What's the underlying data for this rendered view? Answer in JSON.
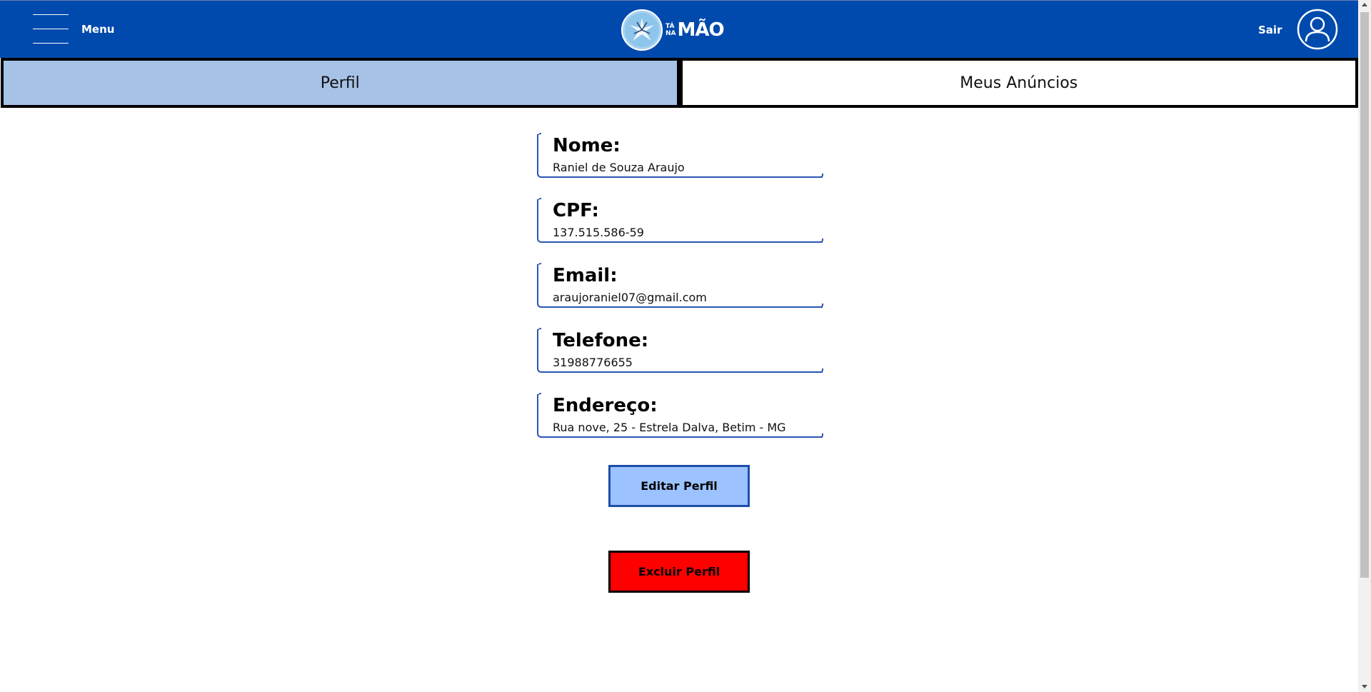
{
  "header": {
    "menu_label": "Menu",
    "logo": {
      "small_top": "TÁ",
      "small_bottom": "NA",
      "big": "MÃO"
    },
    "logout_label": "Sair",
    "background": "#004aad"
  },
  "tabs": [
    {
      "label": "Perfil",
      "active": true
    },
    {
      "label": "Meus Anúncios",
      "active": false
    }
  ],
  "profile": {
    "fields": [
      {
        "label": "Nome:",
        "value": "Raniel de Souza Araujo"
      },
      {
        "label": "CPF:",
        "value": "137.515.586-59"
      },
      {
        "label": "Email:",
        "value": "araujoraniel07@gmail.com"
      },
      {
        "label": "Telefone:",
        "value": "31988776655"
      },
      {
        "label": "Endereço:",
        "value": "Rua nove, 25 - Estrela Dalva, Betim - MG"
      }
    ]
  },
  "actions": {
    "edit_label": "Editar Perfil",
    "edit_color": "#9cc3ff",
    "delete_label": "Excluir Perfil",
    "delete_color": "#ff0000"
  },
  "icons": {
    "menu": "hamburger-icon",
    "logo": "hands-logo-icon",
    "user": "user-avatar-icon"
  }
}
